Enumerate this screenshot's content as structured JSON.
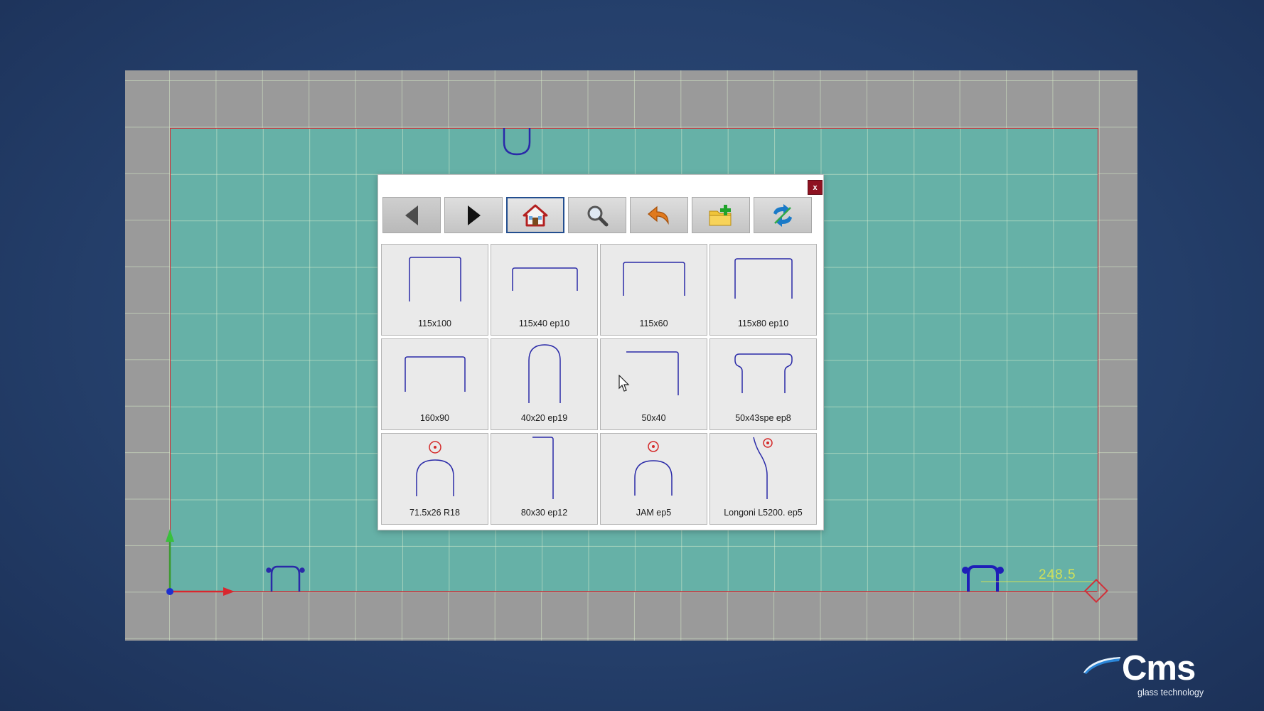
{
  "dialog": {
    "close_label": "x",
    "toolbar": [
      {
        "name": "back",
        "icon": "triangle-left-icon",
        "disabled": true
      },
      {
        "name": "forward",
        "icon": "triangle-right-icon",
        "disabled": false
      },
      {
        "name": "home",
        "icon": "home-icon",
        "active": true
      },
      {
        "name": "search",
        "icon": "magnifier-icon"
      },
      {
        "name": "undo",
        "icon": "undo-arrow-icon"
      },
      {
        "name": "new-folder",
        "icon": "folder-add-icon"
      },
      {
        "name": "refresh",
        "icon": "refresh-icon"
      }
    ],
    "tiles": [
      {
        "label": "115x100"
      },
      {
        "label": "115x40 ep10"
      },
      {
        "label": "115x60"
      },
      {
        "label": "115x80 ep10"
      },
      {
        "label": "160x90"
      },
      {
        "label": "40x20 ep19"
      },
      {
        "label": "50x40"
      },
      {
        "label": "50x43spe ep8"
      },
      {
        "label": "71.5x26 R18"
      },
      {
        "label": "80x30 ep12"
      },
      {
        "label": "JAM ep5"
      },
      {
        "label": "Longoni L5200. ep5"
      }
    ]
  },
  "canvas": {
    "dimension_label": "248.5"
  },
  "logo": {
    "name": "Cms",
    "tagline": "glass technology"
  },
  "colors": {
    "background": "#25406c",
    "sheet": "#66b1a7",
    "canvas": "#9a9a9a",
    "sheet_border": "#d0313a",
    "profile_stroke": "#2a2aa8",
    "close_button": "#8e1221",
    "active_border": "#234e8f"
  }
}
